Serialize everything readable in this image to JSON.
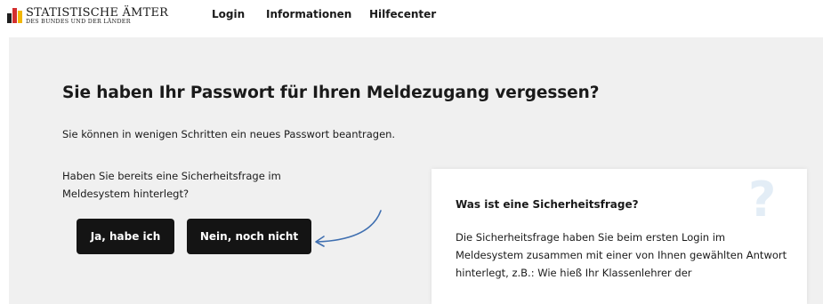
{
  "header": {
    "logo": {
      "title": "STATISTISCHE ÄMTER",
      "subtitle": "DES BUNDES UND DER LÄNDER",
      "colors": [
        "#1f1f1f",
        "#d32f2f",
        "#f2b705"
      ]
    },
    "nav": [
      {
        "label": "Login"
      },
      {
        "label": "Informationen"
      },
      {
        "label": "Hilfecenter"
      }
    ]
  },
  "main": {
    "heading": "Sie haben Ihr Passwort für Ihren Meldezugang vergessen?",
    "intro": "Sie können in wenigen Schritten ein neues Passwort beantragen.",
    "question": "Haben Sie bereits eine Sicherheitsfrage im Meldesystem hinterlegt?",
    "buttons": {
      "yes": "Ja, habe ich",
      "no": "Nein, noch nicht"
    },
    "arrow_color": "#3f6fb0"
  },
  "info_card": {
    "title": "Was ist eine Sicherheitsfrage?",
    "text": "Die Sicherheitsfrage haben Sie beim ersten Login im Meldesystem zusammen mit einer von Ihnen gewählten Antwort hinterlegt, z.B.: Wie hieß Ihr Klassenlehrer der",
    "icon": "question-mark-icon"
  }
}
